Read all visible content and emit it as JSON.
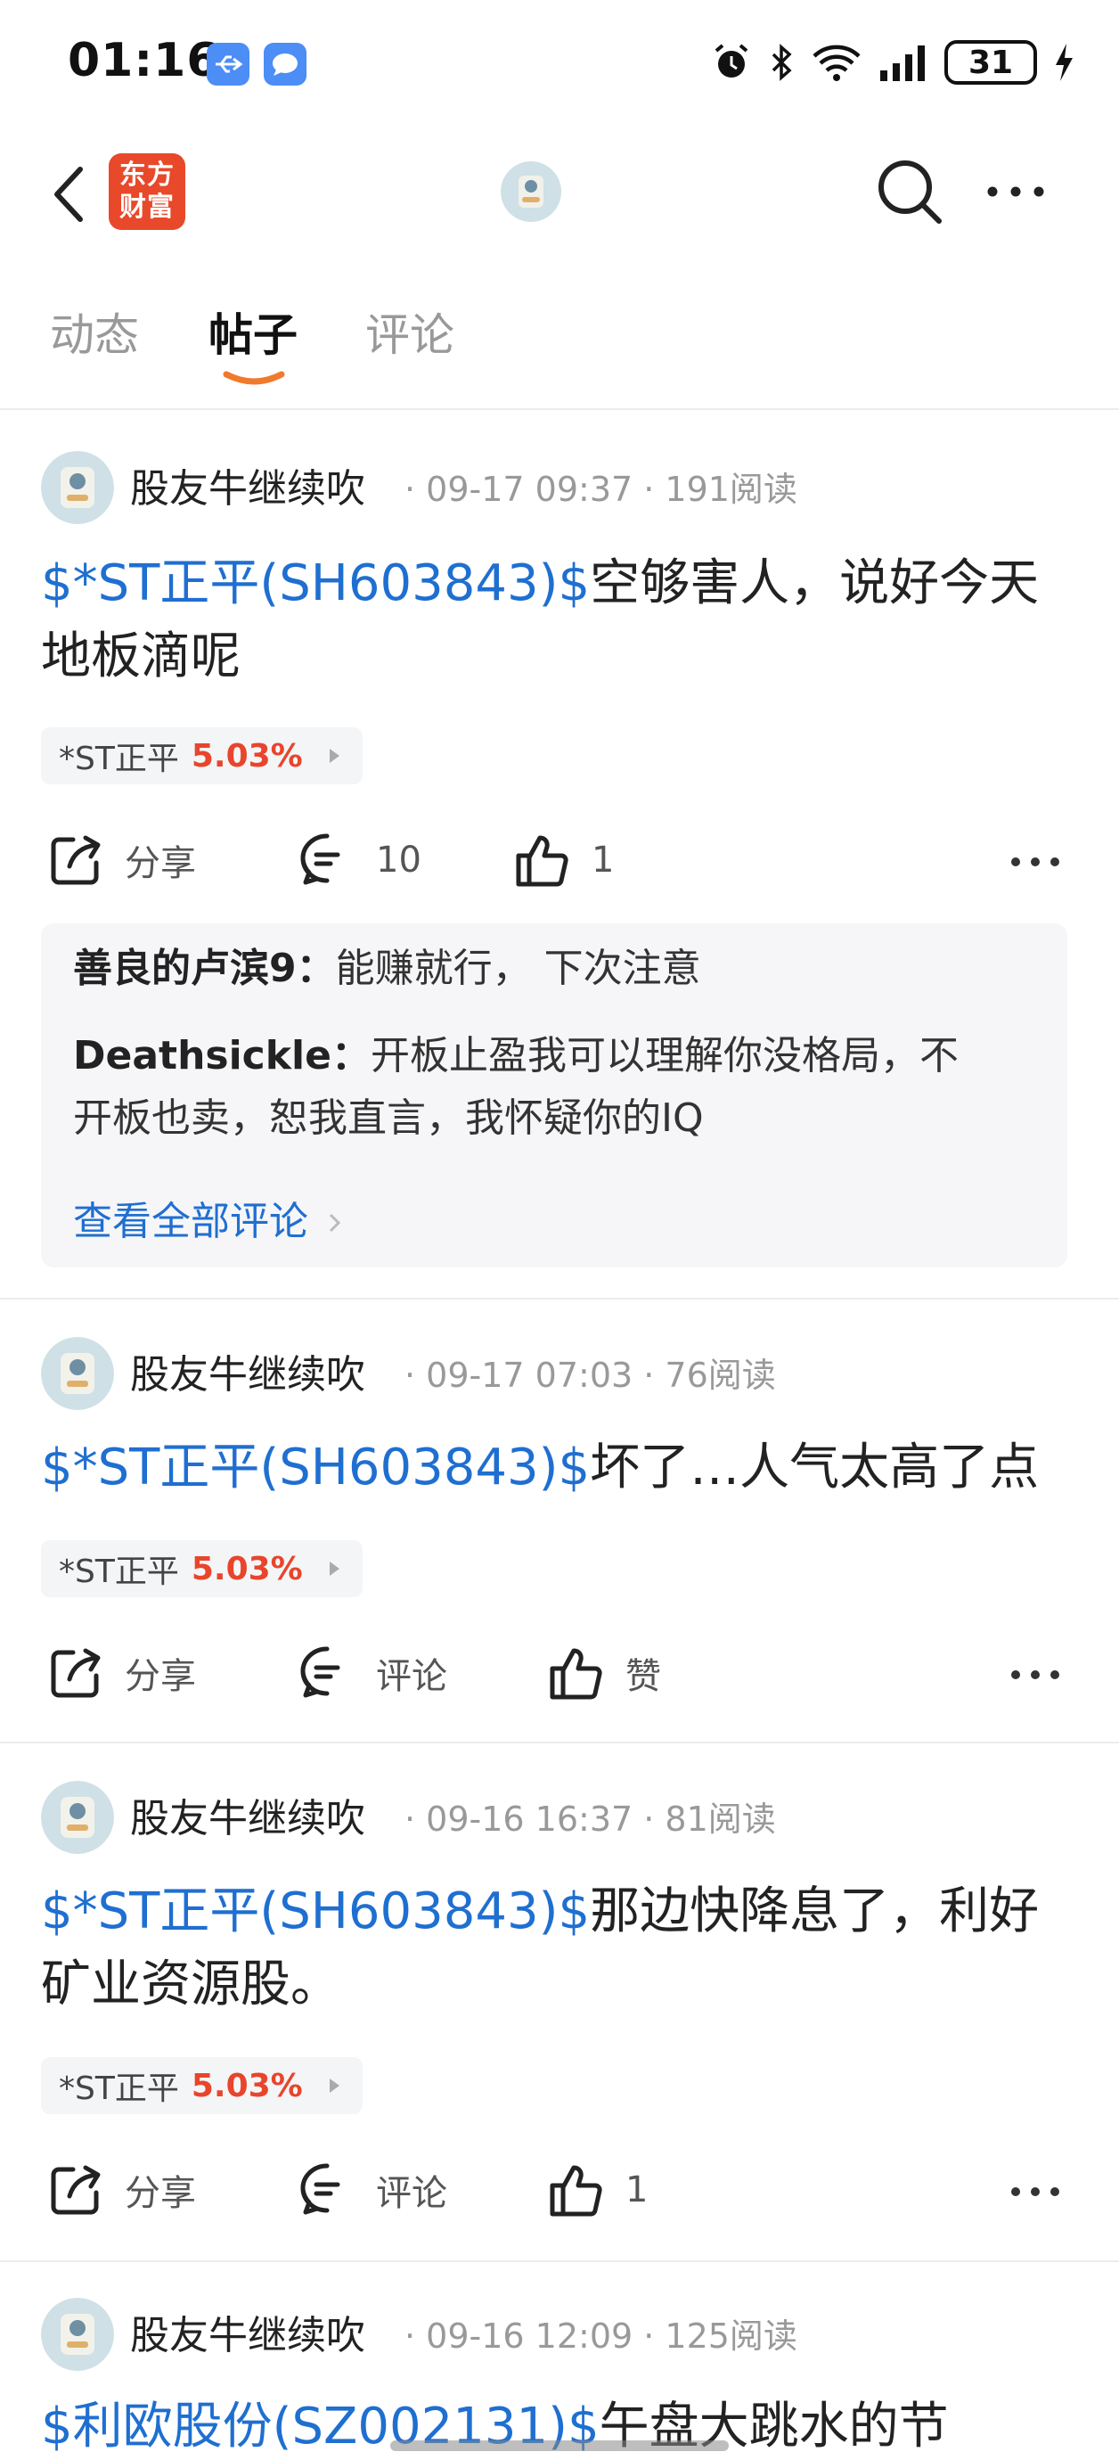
{
  "status_bar": {
    "time": "01:16",
    "battery": "31"
  },
  "header": {
    "logo_line1": "东方",
    "logo_line2": "财富"
  },
  "tabs": [
    {
      "label": "动态"
    },
    {
      "label": "帖子"
    },
    {
      "label": "评论"
    }
  ],
  "posts": [
    {
      "author": "股友牛继续吹",
      "meta": "· 09-17 09:37 · 191阅读",
      "stock_tag": "$*ST正平(SH603843)$",
      "text_line1": "空够害人，说好今天",
      "text_line2": "地板滴呢",
      "chip_name": "*ST正平",
      "chip_pct": "5.03%",
      "share_label": "分享",
      "comment_label": "10",
      "like_label": "1",
      "comments": [
        {
          "user": "善良的卢滨9",
          "sep": "：",
          "text": "能赚就行， 下次注意"
        },
        {
          "user": "Deathsickle",
          "sep": "：",
          "text": "开板止盈我可以理解你没格局，不",
          "text2": "开板也卖，恕我直言，我怀疑你的IQ"
        }
      ],
      "see_all": "查看全部评论"
    },
    {
      "author": "股友牛继续吹",
      "meta": "· 09-17 07:03 · 76阅读",
      "stock_tag": "$*ST正平(SH603843)$",
      "text_line1": "坏了…人气太高了点",
      "chip_name": "*ST正平",
      "chip_pct": "5.03%",
      "share_label": "分享",
      "comment_label": "评论",
      "like_label": "赞"
    },
    {
      "author": "股友牛继续吹",
      "meta": "· 09-16 16:37 · 81阅读",
      "stock_tag": "$*ST正平(SH603843)$",
      "text_line1": "那边快降息了，利好",
      "text_line2": "矿业资源股。",
      "chip_name": "*ST正平",
      "chip_pct": "5.03%",
      "share_label": "分享",
      "comment_label": "评论",
      "like_label": "1"
    },
    {
      "author": "股友牛继续吹",
      "meta": "· 09-16 12:09 · 125阅读",
      "stock_tag": "$利欧股份(SZ002131)$",
      "text_line1": "午盘大跳水的节"
    }
  ],
  "colors": {
    "accent_blue": "#1f6fd1",
    "rise_red": "#e8452c",
    "brand_orange": "#e8492a"
  },
  "icons": [
    "usb-icon",
    "message-icon",
    "alarm-icon",
    "bluetooth-icon",
    "wifi-icon",
    "signal-icon",
    "charging-icon",
    "back-icon",
    "search-icon",
    "more-icon",
    "share-icon",
    "comment-icon",
    "like-icon"
  ]
}
